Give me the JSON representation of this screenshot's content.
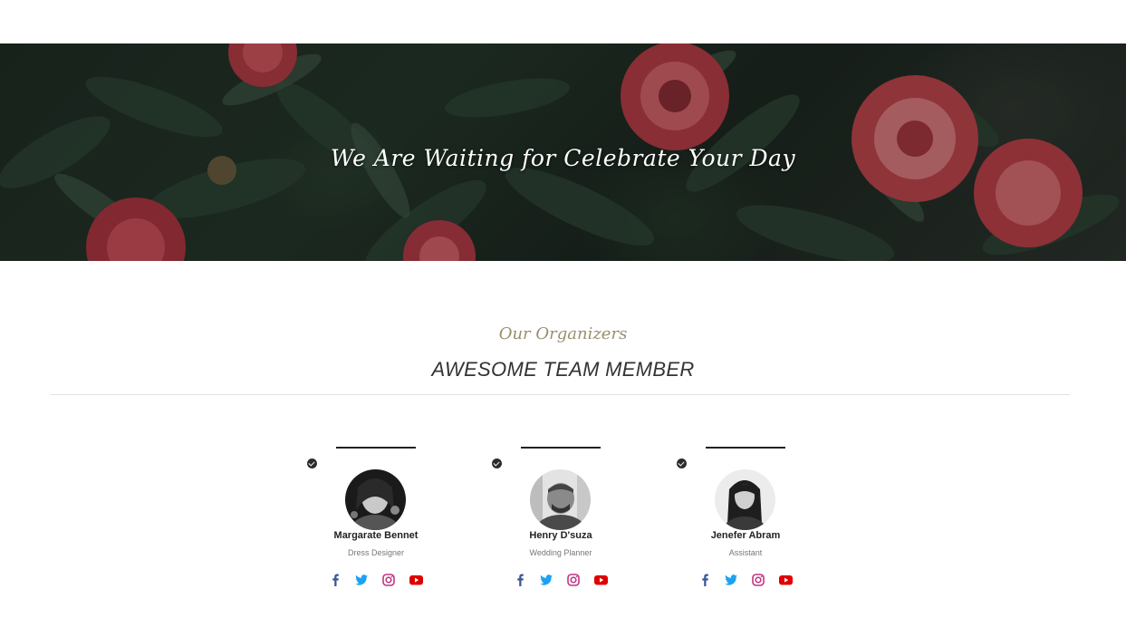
{
  "hero": {
    "title": "We Are Waiting for Celebrate Your Day"
  },
  "section": {
    "eyebrow": "Our Organizers",
    "title": "AWESOME TEAM MEMBER"
  },
  "team": [
    {
      "name": "Margarate Bennet",
      "role": "Dress Designer"
    },
    {
      "name": "Henry D'suza",
      "role": "Wedding Planner"
    },
    {
      "name": "Jenefer Abram",
      "role": "Assistant"
    }
  ],
  "icons": {
    "check": "check-circle-icon",
    "facebook": "facebook-icon",
    "twitter": "twitter-icon",
    "instagram": "instagram-icon",
    "youtube": "youtube-icon"
  },
  "colors": {
    "facebook": "#3b5998",
    "twitter": "#1da1f2",
    "instagram": "#c13584",
    "youtube": "#e00000",
    "eyebrow": "#9a8f6e",
    "heading": "#333333"
  }
}
